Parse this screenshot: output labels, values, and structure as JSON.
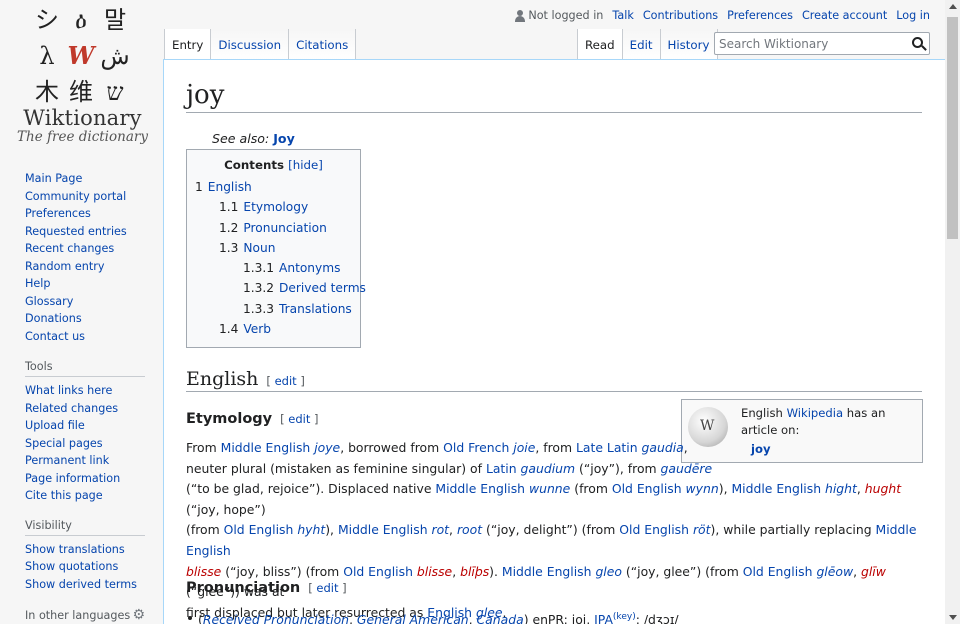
{
  "logo": {
    "glyphs": [
      "シ",
      "ዕ",
      "말",
      "λ",
      "W",
      "ش",
      "木",
      "维",
      "ש"
    ],
    "wordmark": "Wiktionary",
    "tagline": "The free dictionary"
  },
  "sidebar": {
    "navigation": [
      "Main Page",
      "Community portal",
      "Preferences",
      "Requested entries",
      "Recent changes",
      "Random entry",
      "Help",
      "Glossary",
      "Donations",
      "Contact us"
    ],
    "tools_heading": "Tools",
    "tools": [
      "What links here",
      "Related changes",
      "Upload file",
      "Special pages",
      "Permanent link",
      "Page information",
      "Cite this page"
    ],
    "visibility_heading": "Visibility",
    "visibility": [
      "Show translations",
      "Show quotations",
      "Show derived terms"
    ],
    "languages_heading": "In other languages"
  },
  "personal": {
    "not_logged_in": "Not logged in",
    "links": [
      "Talk",
      "Contributions",
      "Preferences",
      "Create account",
      "Log in"
    ]
  },
  "tabs": {
    "left": [
      "Entry",
      "Discussion",
      "Citations"
    ],
    "right": [
      "Read",
      "Edit",
      "History"
    ]
  },
  "search": {
    "placeholder": "Search Wiktionary"
  },
  "page": {
    "title": "joy",
    "see_also_label": "See also:",
    "see_also_link": "Joy"
  },
  "toc": {
    "title": "Contents",
    "hide": "[hide]",
    "items": [
      {
        "num": "1",
        "label": "English"
      },
      {
        "num": "1.1",
        "label": "Etymology"
      },
      {
        "num": "1.2",
        "label": "Pronunciation"
      },
      {
        "num": "1.3",
        "label": "Noun"
      },
      {
        "num": "1.3.1",
        "label": "Antonyms"
      },
      {
        "num": "1.3.2",
        "label": "Derived terms"
      },
      {
        "num": "1.3.3",
        "label": "Translations"
      },
      {
        "num": "1.4",
        "label": "Verb"
      }
    ]
  },
  "sections": {
    "english": "English",
    "etymology": "Etymology",
    "pronunciation": "Pronunciation",
    "edit": "edit"
  },
  "wikipedia_box": {
    "prefix": "English ",
    "link": "Wikipedia",
    "suffix": " has an article on:",
    "article": "joy"
  },
  "etymology": {
    "t01": "From ",
    "t02": "Middle English",
    "t03": "joye",
    "t04": ", borrowed from ",
    "t05": "Old French",
    "t06": "joie",
    "t07": ", from ",
    "t08": "Late Latin",
    "t09": "gaudia",
    "t10": ",",
    "t11": "neuter plural (mistaken as feminine singular) of ",
    "t12": "Latin",
    "t13": "gaudium",
    "t14": " (“joy”), from ",
    "t15": "gaudēre",
    "t16": "(“to be glad, rejoice”). Displaced native ",
    "t17": "Middle English",
    "t18": "wunne",
    "t19": " (from ",
    "t20": "Old English",
    "t21": "wynn",
    "t22": "), ",
    "t23": "Middle English",
    "t24": "hight",
    "t25": ", ",
    "t26": "hught",
    "t27": " (“joy, hope”)",
    "t28": "(from ",
    "t29": "Old English",
    "t30": "hyht",
    "t31": "), ",
    "t32": "Middle English",
    "t33": "rot",
    "t34": ", ",
    "t35": "root",
    "t36": " (“joy, delight”) (from ",
    "t37": "Old English",
    "t38": "röt",
    "t39": "), while partially replacing ",
    "t40": "Middle English",
    "t41": "blisse",
    "t42": " (“joy, bliss”) (from ",
    "t43": "Old English",
    "t44": "blisse",
    "t45": ", ",
    "t46": "blīþs",
    "t47": "). ",
    "t48": "Middle English",
    "t49": "gleo",
    "t50": " (“joy, glee”) (from ",
    "t51": "Old English",
    "t52": "glēow",
    "t53": ", ",
    "t54": "glīw",
    "t55": " (“glee”)) was at",
    "t56": "first displaced but later resurrected as ",
    "t57": "English",
    "t58": "glee",
    "t59": "."
  },
  "pronunciation": {
    "open": "(",
    "rp": "Received Pronunciation",
    "comma1": ", ",
    "ga": "General American",
    "comma2": ", ",
    "ca": "Canada",
    "close": ") enPR: ",
    "enpr": "joi",
    "comma3": ", ",
    "ipa": "IPA",
    "key": "(key)",
    "colon": ": ",
    "ipa_value": "/dʒɔɪ/"
  }
}
